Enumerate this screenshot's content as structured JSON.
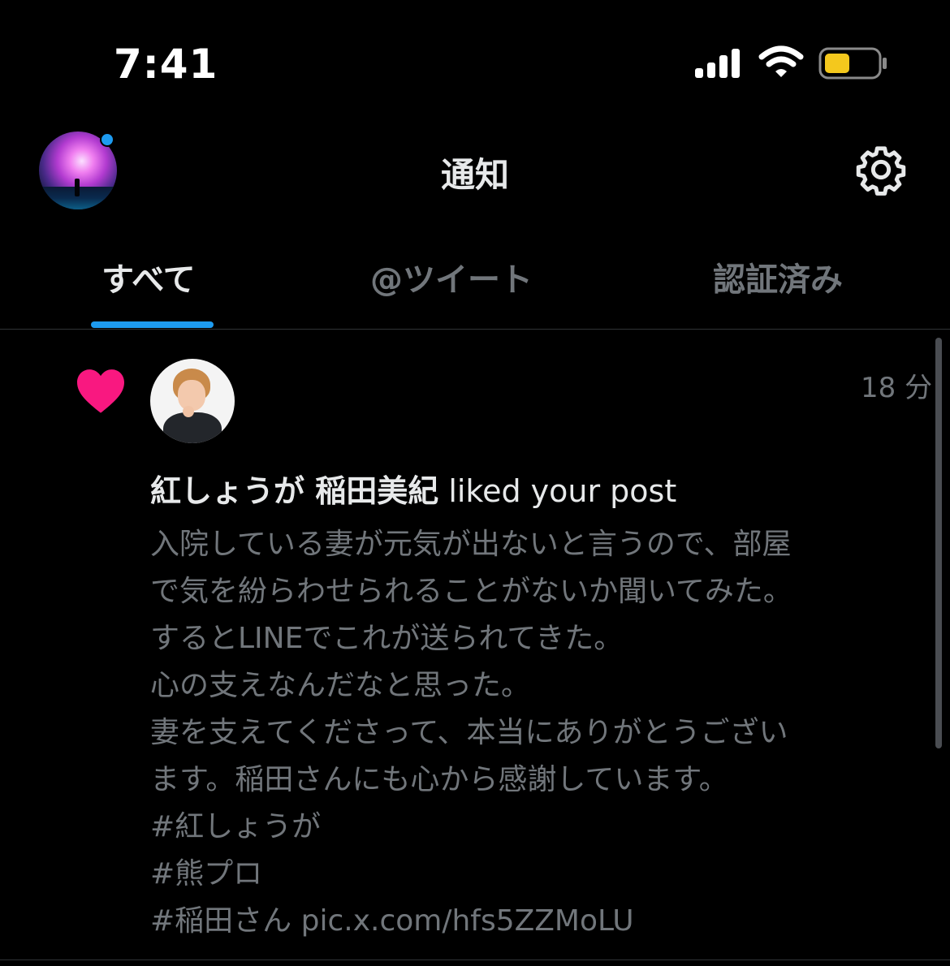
{
  "status_bar": {
    "time": "7:41",
    "icons": [
      "signal-icon",
      "wifi-icon",
      "battery-icon"
    ],
    "battery_color": "#f4c81d"
  },
  "header": {
    "title": "通知",
    "has_unread_dot": true,
    "settings_icon": "gear-icon"
  },
  "tabs": [
    {
      "label": "すべて",
      "active": true
    },
    {
      "label": "@ツイート",
      "active": false
    },
    {
      "label": "認証済み",
      "active": false
    }
  ],
  "notification": {
    "type_icon": "heart-icon",
    "time": "18 分",
    "actor_name": "紅しょうが 稲田美紀",
    "action_text": " liked your post",
    "post_lines": [
      "入院している妻が元気が出ないと言うので、部屋",
      "で気を紛らわせられることがないか聞いてみた。",
      "するとLINEでこれが送られてきた。",
      "心の支えなんだなと思った。",
      "妻を支えてくださって、本当にありがとうござい",
      "ます。稲田さんにも心から感謝しています。",
      "#紅しょうが",
      "#熊プロ",
      "#稲田さん pic.x.com/hfs5ZZMoLU"
    ]
  },
  "colors": {
    "accent": "#1d9bf0",
    "like": "#f91880",
    "text_primary": "#e7e9ea",
    "text_secondary": "#71767b",
    "background": "#000000"
  }
}
